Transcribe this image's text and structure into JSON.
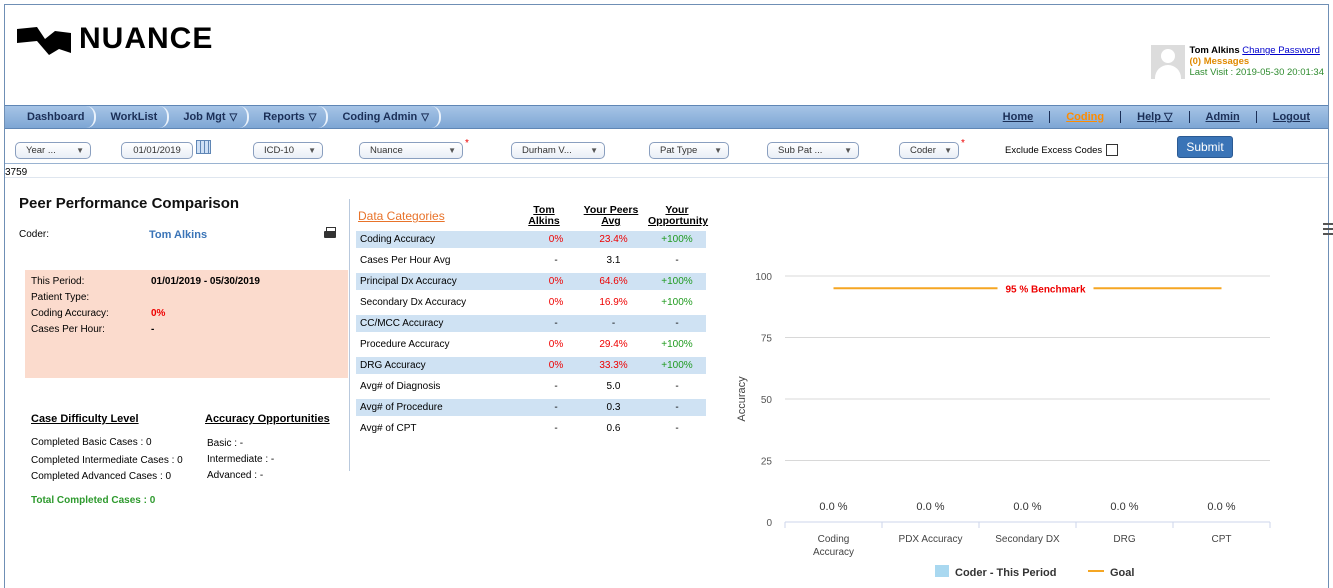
{
  "brand": {
    "name": "NUANCE"
  },
  "user": {
    "name": "Tom Alkins",
    "change_password": "Change Password",
    "messages": "(0) Messages",
    "last_visit": "Last Visit : 2019-05-30 20:01:34"
  },
  "nav": {
    "left": [
      {
        "label": "Dashboard",
        "caret": false
      },
      {
        "label": "WorkList",
        "caret": false
      },
      {
        "label": "Job Mgt",
        "caret": true
      },
      {
        "label": "Reports",
        "caret": true
      },
      {
        "label": "Coding Admin",
        "caret": true
      }
    ],
    "right": {
      "home": "Home",
      "coding": "Coding",
      "help": "Help",
      "admin": "Admin",
      "logout": "Logout"
    }
  },
  "filters": {
    "year": "Year ...",
    "date": "01/01/2019",
    "code_set": "ICD-10",
    "client": "Nuance",
    "facility": "Durham V...",
    "pat_type": "Pat Type",
    "sub_pat": "Sub Pat ...",
    "coder": "Coder",
    "exclude_label": "Exclude Excess Codes",
    "submit_label": "Submit"
  },
  "code_id": "3759",
  "panel": {
    "title": "Peer Performance Comparison",
    "coder_label": "Coder:",
    "coder_value": "Tom Alkins",
    "period_label": "This Period:",
    "period_value": "01/01/2019 - 05/30/2019",
    "patient_type_label": "Patient Type:",
    "coding_accuracy_label": "Coding Accuracy:",
    "coding_accuracy_value": "0%",
    "cases_per_hour_label": "Cases Per Hour:",
    "cases_per_hour_value": "-",
    "case_difficulty_title": "Case Difficulty Level",
    "accuracy_opp_title": "Accuracy Opportunities",
    "completed_basic": "Completed Basic Cases : 0",
    "completed_intermediate": "Completed Intermediate Cases : 0",
    "completed_advanced": "Completed Advanced Cases : 0",
    "basic": "Basic : -",
    "intermediate": "Intermediate : -",
    "advanced": "Advanced : -",
    "total_completed": "Total Completed Cases : 0"
  },
  "table": {
    "header_categories": "Data Categories",
    "header_coder_1": "Tom",
    "header_coder_2": "Alkins",
    "header_peers_1": "Your Peers",
    "header_peers_2": "Avg",
    "header_opp_1": "Your",
    "header_opp_2": "Opportunity",
    "rows": [
      {
        "category": "Coding Accuracy",
        "coder": "0%",
        "peers": "23.4%",
        "opp": "+100%",
        "shade": true,
        "colored": true
      },
      {
        "category": "Cases Per Hour Avg",
        "coder": "-",
        "peers": "3.1",
        "opp": "-",
        "shade": false,
        "colored": false
      },
      {
        "category": "Principal Dx Accuracy",
        "coder": "0%",
        "peers": "64.6%",
        "opp": "+100%",
        "shade": true,
        "colored": true
      },
      {
        "category": "Secondary Dx Accuracy",
        "coder": "0%",
        "peers": "16.9%",
        "opp": "+100%",
        "shade": false,
        "colored": true
      },
      {
        "category": "CC/MCC Accuracy",
        "coder": "-",
        "peers": "-",
        "opp": "-",
        "shade": true,
        "colored": false
      },
      {
        "category": "Procedure Accuracy",
        "coder": "0%",
        "peers": "29.4%",
        "opp": "+100%",
        "shade": false,
        "colored": true
      },
      {
        "category": "DRG Accuracy",
        "coder": "0%",
        "peers": "33.3%",
        "opp": "+100%",
        "shade": true,
        "colored": true
      },
      {
        "category": "Avg# of Diagnosis",
        "coder": "-",
        "peers": "5.0",
        "opp": "-",
        "shade": false,
        "colored": false
      },
      {
        "category": "Avg# of Procedure",
        "coder": "-",
        "peers": "0.3",
        "opp": "-",
        "shade": true,
        "colored": false
      },
      {
        "category": "Avg# of CPT",
        "coder": "-",
        "peers": "0.6",
        "opp": "-",
        "shade": false,
        "colored": false
      }
    ]
  },
  "colors": {
    "nav_gradient_top": "#a6c4e6",
    "accent_blue": "#3a74b7",
    "coding_orange": "#ff8c00",
    "period_bg": "#fbdbcd",
    "row_shade": "#cfe2f3",
    "benchmark_orange": "#f5a623",
    "bar_blue": "#a9d8f0"
  },
  "chart_data": {
    "type": "bar",
    "categories": [
      "Coding Accuracy",
      "PDX Accuracy",
      "Secondary DX",
      "DRG",
      "CPT"
    ],
    "series": [
      {
        "name": "Coder - This Period",
        "values": [
          0,
          0,
          0,
          0,
          0
        ],
        "color": "#a9d8f0"
      }
    ],
    "data_labels": [
      "0.0 %",
      "0.0 %",
      "0.0 %",
      "0.0 %",
      "0.0 %"
    ],
    "goal": {
      "name": "Goal",
      "value": 95,
      "label": "95 % Benchmark",
      "color": "#f5a623"
    },
    "ylabel": "Accuracy",
    "ylim": [
      0,
      100
    ],
    "yticks": [
      0,
      25,
      50,
      75,
      100
    ],
    "grid": true,
    "legend": "bottom"
  }
}
